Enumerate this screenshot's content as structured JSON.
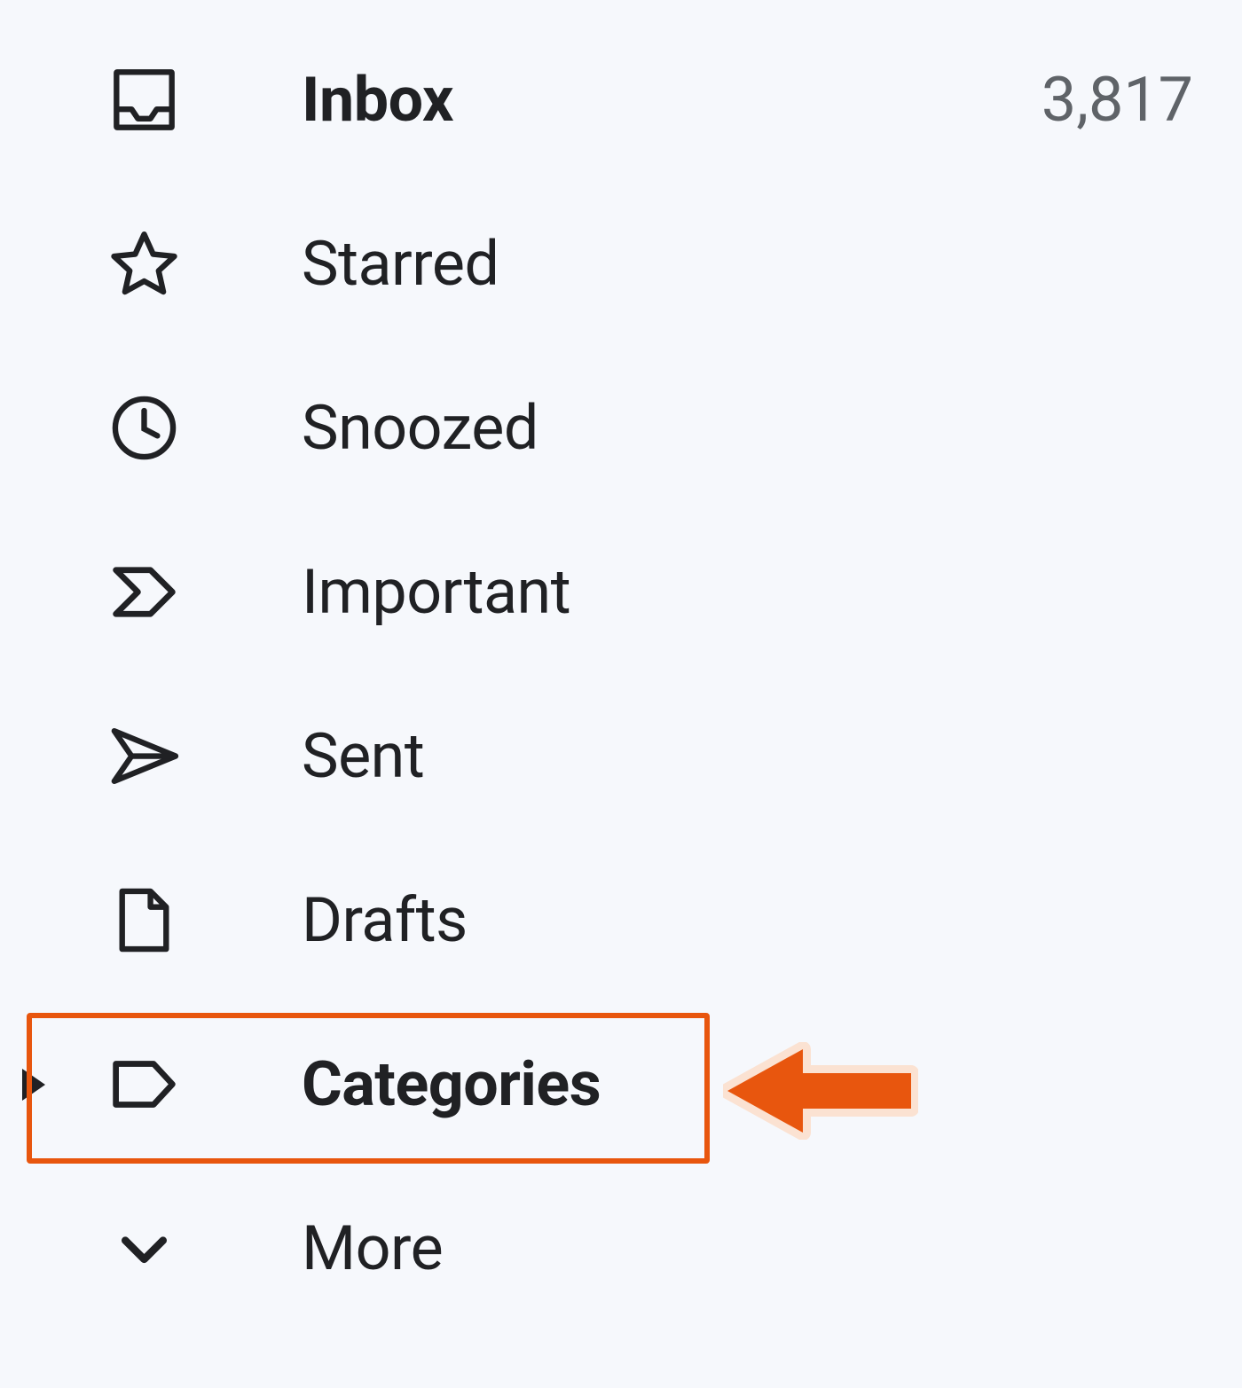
{
  "sidebar": {
    "items": [
      {
        "label": "Inbox",
        "count": "3,817"
      },
      {
        "label": "Starred",
        "count": ""
      },
      {
        "label": "Snoozed",
        "count": ""
      },
      {
        "label": "Important",
        "count": ""
      },
      {
        "label": "Sent",
        "count": ""
      },
      {
        "label": "Drafts",
        "count": ""
      },
      {
        "label": "Categories",
        "count": ""
      },
      {
        "label": "More",
        "count": ""
      }
    ]
  },
  "annotation": {
    "highlight_target": "Categories",
    "arrow_color": "#e8560e"
  }
}
